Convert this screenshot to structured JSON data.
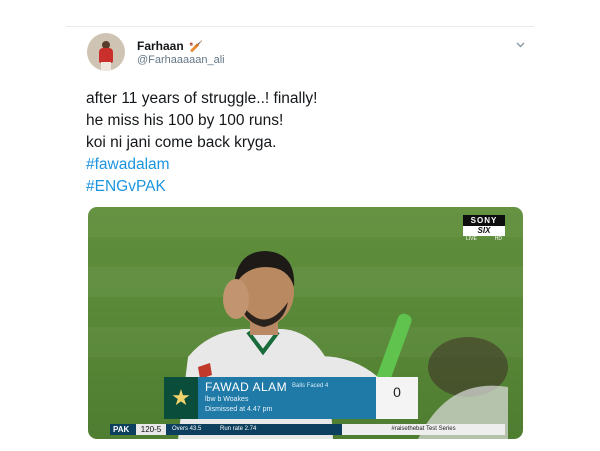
{
  "tweet": {
    "author_name": "Farhaan",
    "author_emoji": "🏏",
    "handle": "@Farhaaaaan_ali",
    "lines": [
      "after 11 years of struggle..! finally!",
      "he miss his 100 by 100 runs!",
      "koi ni jani come back kryga."
    ],
    "hashtags": [
      "#fawadalam",
      "#ENGvPAK"
    ],
    "menu_icon": "chevron-down-icon"
  },
  "media": {
    "broadcaster": {
      "top": "SONY",
      "middle": "SIX",
      "live": "LIVE",
      "hd": "HD"
    },
    "scorecard": {
      "player": "FAWAD ALAM",
      "balls_label": "Balls Faced 4",
      "dismissal": "lbw b Woakes",
      "time": "Dismissed at 4.47 pm",
      "runs": "0",
      "icon": "star-icon"
    },
    "score_bar": {
      "team": "PAK",
      "score": "120-5",
      "overs": "Overs 43.5",
      "run_rate": "Run rate 2.74",
      "series": "#raisethebat Test Series"
    }
  },
  "colors": {
    "hashtag": "#1b95e0",
    "text": "#14171a",
    "muted": "#657786"
  }
}
